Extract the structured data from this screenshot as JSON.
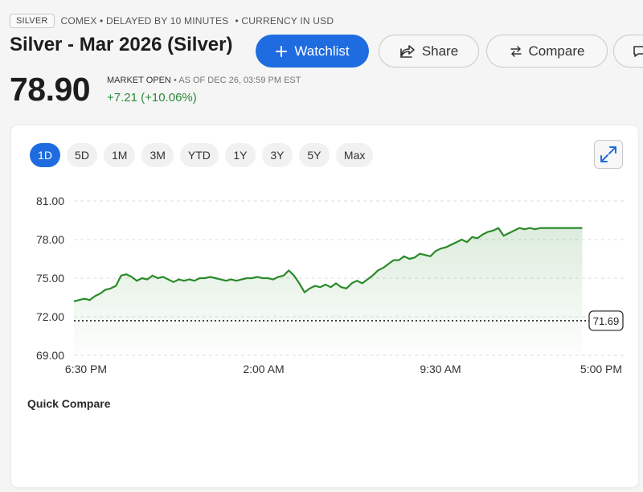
{
  "header": {
    "ticker": "SILVER",
    "exchange_info": "COMEX • DELAYED BY 10 MINUTES",
    "currency_info": "• CURRENCY IN USD",
    "title": "Silver - Mar 2026 (Silver)"
  },
  "actions": {
    "watchlist_label": "Watchlist",
    "share_label": "Share",
    "compare_label": "Compare"
  },
  "quote": {
    "price": "78.90",
    "status": "MARKET OPEN",
    "as_of": "• AS OF DEC 26, 03:59 PM EST",
    "change": "+7.21 (+10.06%)"
  },
  "ranges": [
    "1D",
    "5D",
    "1M",
    "3M",
    "YTD",
    "1Y",
    "3Y",
    "5Y",
    "Max"
  ],
  "active_range": "1D",
  "colors": {
    "accent": "#1f6ce0",
    "positive": "#2a8a3a",
    "line": "#2a8a2a"
  },
  "icons": {
    "watchlist": "plus-icon",
    "share": "share-icon",
    "compare": "swap-arrows-icon",
    "more": "comment-icon",
    "expand": "expand-icon"
  },
  "quick_compare_label": "Quick Compare",
  "chart_data": {
    "type": "area",
    "x_ticks": [
      "6:30 PM",
      "2:00 AM",
      "9:30 AM",
      "5:00 PM"
    ],
    "y_ticks": [
      "81.00",
      "78.00",
      "75.00",
      "72.00",
      "69.00"
    ],
    "ylim": [
      69,
      81
    ],
    "grid": true,
    "previous_close": 71.69,
    "previous_close_label": "71.69",
    "series": [
      {
        "x": [
          0.0,
          0.01,
          0.02,
          0.03,
          0.04,
          0.05,
          0.06,
          0.07,
          0.08,
          0.09,
          0.1,
          0.11,
          0.12,
          0.13,
          0.14,
          0.15,
          0.16,
          0.17,
          0.18,
          0.19,
          0.2,
          0.21,
          0.22,
          0.23,
          0.24,
          0.25,
          0.26,
          0.27,
          0.28,
          0.29,
          0.3,
          0.31,
          0.32,
          0.33,
          0.34,
          0.35,
          0.36,
          0.37,
          0.38,
          0.39,
          0.4,
          0.41,
          0.42,
          0.43,
          0.44,
          0.45,
          0.46,
          0.47,
          0.48,
          0.49,
          0.5,
          0.51,
          0.52,
          0.53,
          0.54,
          0.55,
          0.56,
          0.57,
          0.58,
          0.59,
          0.6,
          0.61,
          0.62,
          0.63,
          0.64,
          0.65,
          0.66,
          0.67,
          0.68,
          0.69,
          0.7,
          0.71,
          0.72,
          0.73,
          0.74,
          0.75,
          0.76,
          0.77,
          0.78,
          0.79,
          0.8,
          0.81,
          0.82,
          0.83,
          0.84,
          0.85,
          0.86,
          0.87,
          0.88,
          0.89,
          0.9,
          0.91,
          0.92,
          0.93,
          0.94,
          0.95,
          0.96,
          0.97
        ],
        "values": [
          73.2,
          73.3,
          73.4,
          73.3,
          73.6,
          73.8,
          74.1,
          74.2,
          74.4,
          75.2,
          75.3,
          75.1,
          74.8,
          75.0,
          74.9,
          75.2,
          75.0,
          75.1,
          74.9,
          74.7,
          74.9,
          74.8,
          74.9,
          74.8,
          75.0,
          75.0,
          75.1,
          75.0,
          74.9,
          74.8,
          74.9,
          74.8,
          74.9,
          75.0,
          75.0,
          75.1,
          75.0,
          75.0,
          74.9,
          75.1,
          75.2,
          75.6,
          75.2,
          74.6,
          73.9,
          74.2,
          74.4,
          74.3,
          74.5,
          74.3,
          74.6,
          74.3,
          74.2,
          74.6,
          74.8,
          74.6,
          74.9,
          75.2,
          75.6,
          75.8,
          76.1,
          76.4,
          76.4,
          76.7,
          76.5,
          76.6,
          76.9,
          76.8,
          76.7,
          77.1,
          77.3,
          77.4,
          77.6,
          77.8,
          78.0,
          77.8,
          78.2,
          78.1,
          78.4,
          78.6,
          78.7,
          78.9,
          78.3,
          78.5,
          78.7,
          78.9,
          78.8,
          78.9,
          78.8,
          78.9,
          78.9,
          78.9,
          78.9,
          78.9,
          78.9,
          78.9,
          78.9,
          78.9
        ]
      }
    ]
  }
}
